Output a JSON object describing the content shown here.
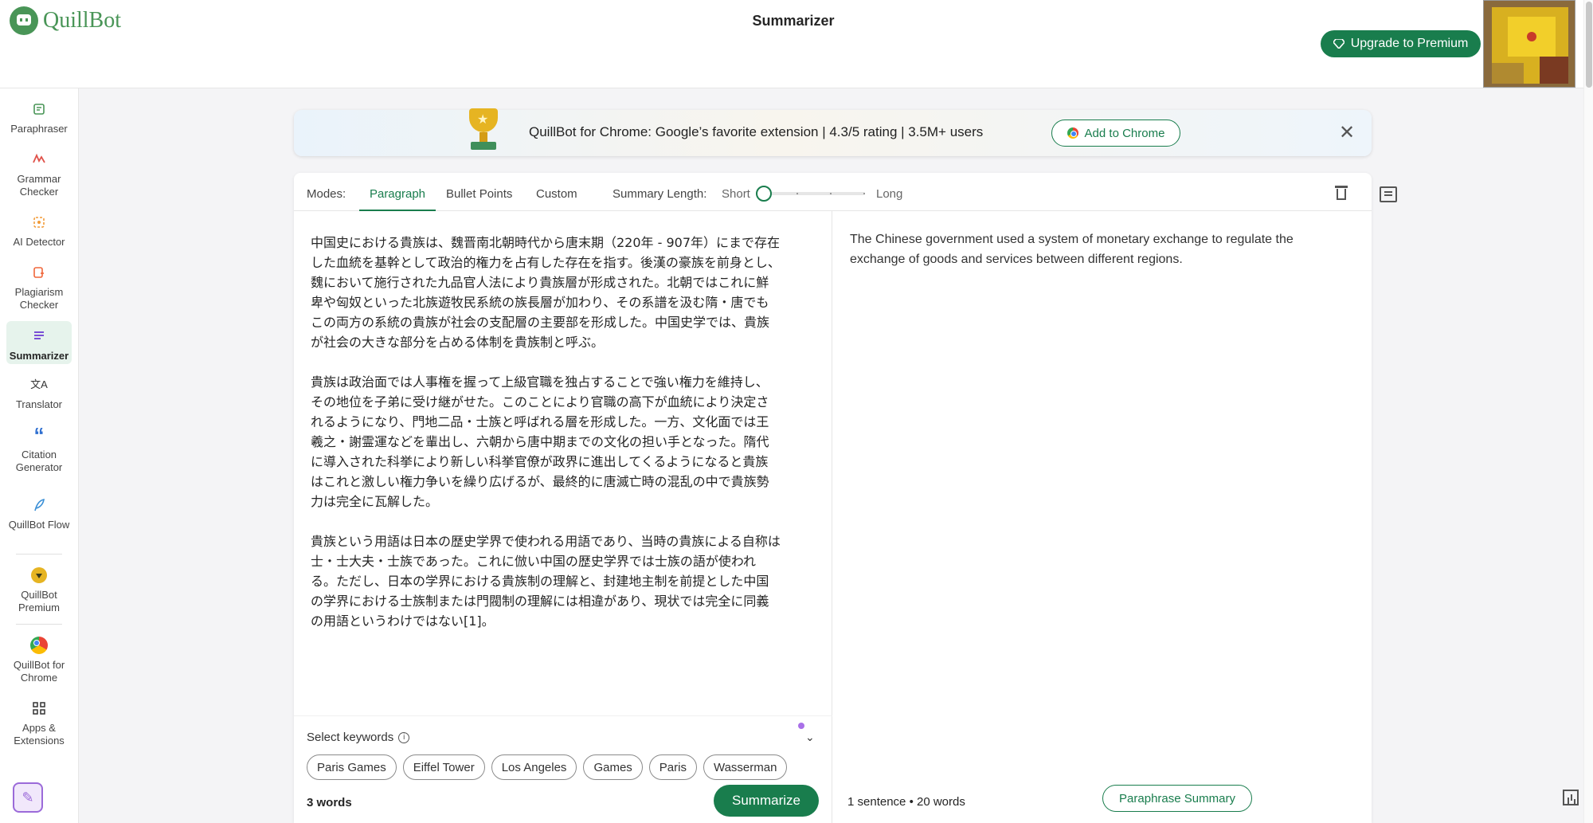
{
  "header": {
    "logo_text": "QuillBot",
    "title": "Summarizer",
    "upgrade_label": "Upgrade to Premium"
  },
  "sidebar": {
    "items": [
      {
        "label": "Paraphraser",
        "icon": "paraphraser-icon"
      },
      {
        "label": "Grammar Checker",
        "icon": "grammar-icon"
      },
      {
        "label": "AI Detector",
        "icon": "ai-detector-icon"
      },
      {
        "label": "Plagiarism Checker",
        "icon": "plagiarism-icon"
      },
      {
        "label": "Summarizer",
        "icon": "summarizer-icon",
        "active": true
      },
      {
        "label": "Translator",
        "icon": "translate-icon"
      },
      {
        "label": "Citation Generator",
        "icon": "quote-icon"
      },
      {
        "label": "QuillBot Flow",
        "icon": "feather-icon"
      },
      {
        "label": "QuillBot Premium",
        "icon": "diamond-icon"
      },
      {
        "label": "QuillBot for Chrome",
        "icon": "chrome-icon"
      },
      {
        "label": "Apps & Extensions",
        "icon": "grid-icon"
      }
    ]
  },
  "banner": {
    "text": "QuillBot for Chrome: Google’s favorite extension  |  4.3/5 rating  |  3.5M+ users",
    "button_label": "Add to Chrome"
  },
  "modes": {
    "label": "Modes:",
    "tabs": [
      "Paragraph",
      "Bullet Points",
      "Custom"
    ],
    "active_tab": "Paragraph",
    "length_label": "Summary Length:",
    "short_label": "Short",
    "long_label": "Long",
    "length_value": 0
  },
  "input": {
    "paragraphs": [
      "中国史における貴族は、魏晋南北朝時代から唐末期（220年 - 907年）にまで存在した血統を基幹として政治的権力を占有した存在を指す。後漢の豪族を前身とし、魏において施行された九品官人法により貴族層が形成された。北朝ではこれに鮮卑や匈奴といった北族遊牧民系統の族長層が加わり、その系譜を汲む隋・唐でもこの両方の系統の貴族が社会の支配層の主要部を形成した。中国史学では、貴族が社会の大きな部分を占める体制を貴族制と呼ぶ。",
      "貴族は政治面では人事権を握って上級官職を独占することで強い権力を維持し、その地位を子弟に受け継がせた。このことにより官職の高下が血統により決定されるようになり、門地二品・士族と呼ばれる層を形成した。一方、文化面では王羲之・謝霊運などを輩出し、六朝から唐中期までの文化の担い手となった。隋代に導入された科挙により新しい科挙官僚が政界に進出してくるようになると貴族はこれと激しい権力争いを繰り広げるが、最終的に唐滅亡時の混乱の中で貴族勢力は完全に瓦解した。",
      "貴族という用語は日本の歴史学界で使われる用語であり、当時の貴族による自称は士・士大夫・士族であった。これに倣い中国の歴史学界では士族の語が使われる。ただし、日本の学界における貴族制の理解と、封建地主制を前提とした中国の学界における士族制または門閥制の理解には相違があり、現状では完全に同義の用語というわけではない[1]。"
    ],
    "keywords_title": "Select keywords",
    "keywords": [
      "Paris Games",
      "Eiffel Tower",
      "Los Angeles",
      "Games",
      "Paris",
      "Wasserman"
    ],
    "word_count": "3 words",
    "summarize_label": "Summarize"
  },
  "output": {
    "text": "The Chinese government used a system of monetary exchange to regulate the exchange of goods and services between different regions.",
    "sentences": "1 sentence",
    "words": "20 words",
    "paraphrase_label": "Paraphrase Summary"
  },
  "colors": {
    "accent": "#197d4d",
    "brand": "#499557",
    "keyword_dot": "#a970e8"
  }
}
